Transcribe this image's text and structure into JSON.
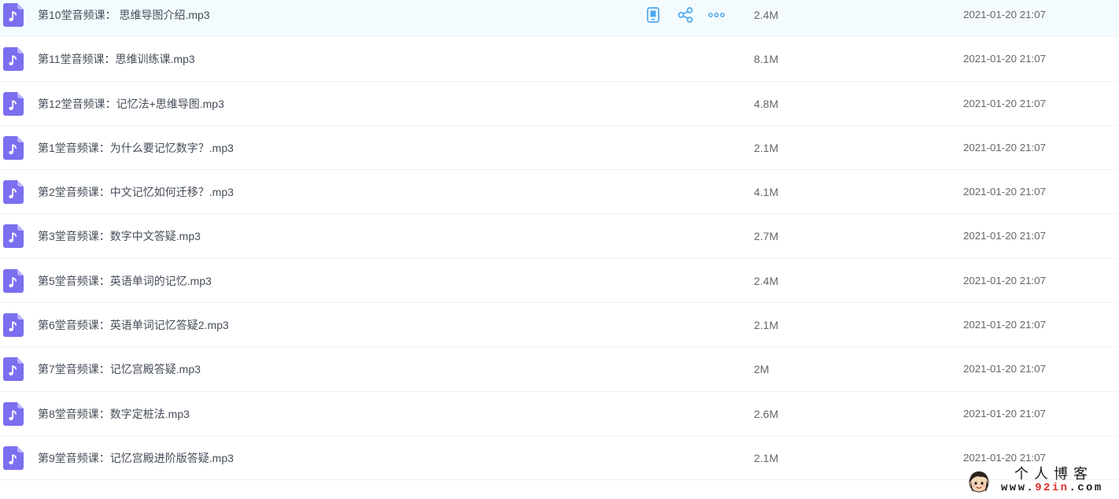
{
  "files": [
    {
      "name": "第10堂音频课： 思维导图介绍.mp3",
      "size": "2.4M",
      "date": "2021-01-20 21:07",
      "icon": "music-file-icon"
    },
    {
      "name": "第11堂音频课：思维训练课.mp3",
      "size": "8.1M",
      "date": "2021-01-20 21:07",
      "icon": "music-file-icon"
    },
    {
      "name": "第12堂音频课：记忆法+思维导图.mp3",
      "size": "4.8M",
      "date": "2021-01-20 21:07",
      "icon": "music-file-icon"
    },
    {
      "name": "第1堂音频课：为什么要记忆数字？.mp3",
      "size": "2.1M",
      "date": "2021-01-20 21:07",
      "icon": "music-file-icon"
    },
    {
      "name": "第2堂音频课：中文记忆如何迁移？.mp3",
      "size": "4.1M",
      "date": "2021-01-20 21:07",
      "icon": "music-file-icon"
    },
    {
      "name": "第3堂音频课：数字中文答疑.mp3",
      "size": "2.7M",
      "date": "2021-01-20 21:07",
      "icon": "music-file-icon"
    },
    {
      "name": "第5堂音频课：英语单词的记忆.mp3",
      "size": "2.4M",
      "date": "2021-01-20 21:07",
      "icon": "music-file-icon"
    },
    {
      "name": "第6堂音频课：英语单词记忆答疑2.mp3",
      "size": "2.1M",
      "date": "2021-01-20 21:07",
      "icon": "music-file-icon"
    },
    {
      "name": "第7堂音频课：记忆宫殿答疑.mp3",
      "size": "2M",
      "date": "2021-01-20 21:07",
      "icon": "music-file-icon"
    },
    {
      "name": "第8堂音频课：数字定桩法.mp3",
      "size": "2.6M",
      "date": "2021-01-20 21:07",
      "icon": "music-file-icon"
    },
    {
      "name": "第9堂音频课：记忆宫殿进阶版答疑.mp3",
      "size": "2.1M",
      "date": "2021-01-20 21:07",
      "icon": "music-file-icon"
    }
  ],
  "hover_actions": {
    "icons": [
      "phone-icon",
      "share-icon",
      "more-icon"
    ]
  },
  "watermark": {
    "title": "个人博客",
    "url_prefix": "www.",
    "url_highlight": "92in",
    "url_suffix": ".com"
  },
  "colors": {
    "file_icon": "#7b6ff0",
    "accent": "#4da8ee",
    "hover_row_bg": "#f4fbff",
    "watermark_highlight": "#e0302a"
  }
}
